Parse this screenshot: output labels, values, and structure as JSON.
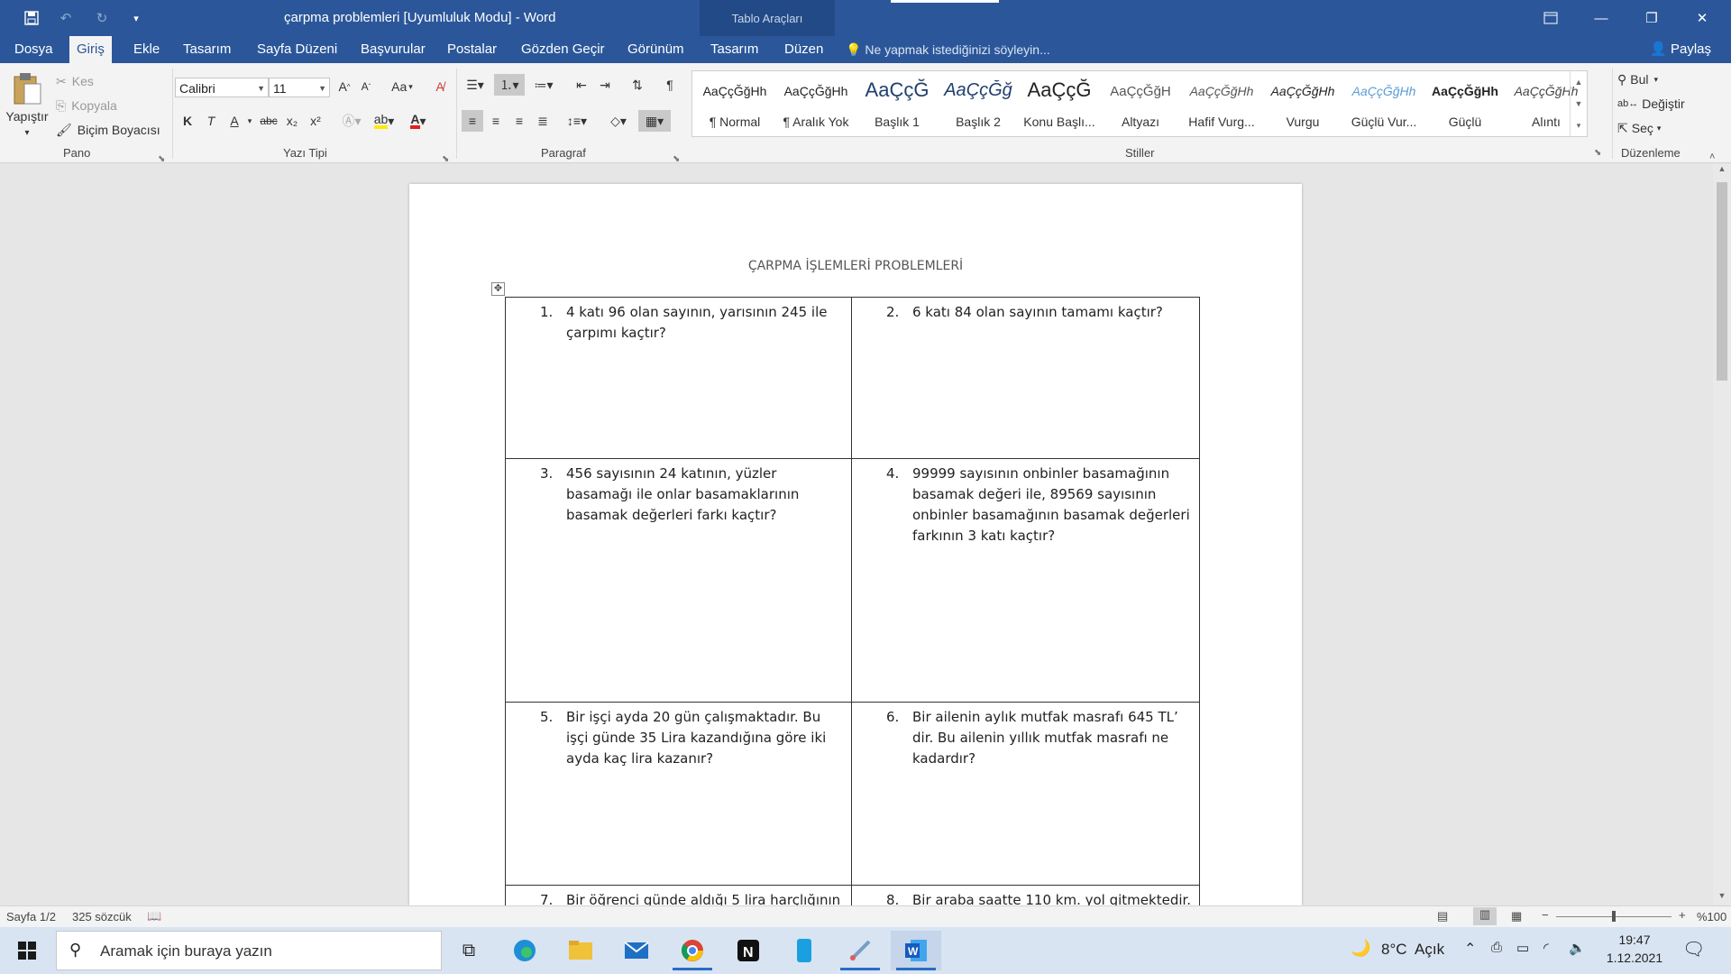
{
  "titlebar": {
    "doc_title": "çarpma problemleri [Uyumluluk Modu] - Word",
    "context_group": "Tablo Araçları"
  },
  "tabs": [
    "Dosya",
    "Giriş",
    "Ekle",
    "Tasarım",
    "Sayfa Düzeni",
    "Başvurular",
    "Postalar",
    "Gözden Geçir",
    "Görünüm",
    "Tasarım",
    "Düzen"
  ],
  "tell_me": "Ne yapmak istediğinizi söyleyin...",
  "share": "Paylaş",
  "ribbon": {
    "clipboard": {
      "paste": "Yapıştır",
      "cut": "Kes",
      "copy": "Kopyala",
      "format_painter": "Biçim Boyacısı",
      "label": "Pano"
    },
    "font": {
      "name": "Calibri",
      "size": "11",
      "label": "Yazı Tipi",
      "bold": "K",
      "italic": "T",
      "underline": "A",
      "strike": "abc",
      "sub": "x₂",
      "sup": "x²",
      "case": "Aa",
      "grow": "A",
      "shrink": "A"
    },
    "paragraph": {
      "label": "Paragraf"
    },
    "styles": {
      "label": "Stiller",
      "items": [
        {
          "preview": "AaÇçĞğHh",
          "name": "¶ Normal"
        },
        {
          "preview": "AaÇçĞğHh",
          "name": "¶ Aralık Yok"
        },
        {
          "preview": "AaÇçĞ",
          "name": "Başlık 1"
        },
        {
          "preview": "AaÇçĞğ",
          "name": "Başlık 2"
        },
        {
          "preview": "AaÇçĞ",
          "name": "Konu Başlı..."
        },
        {
          "preview": "AaÇçĞğH",
          "name": "Altyazı"
        },
        {
          "preview": "AaÇçĞğHh",
          "name": "Hafif Vurg..."
        },
        {
          "preview": "AaÇçĞğHh",
          "name": "Vurgu"
        },
        {
          "preview": "AaÇçĞğHh",
          "name": "Güçlü Vur..."
        },
        {
          "preview": "AaÇçĞğHh",
          "name": "Güçlü"
        },
        {
          "preview": "AaÇçĞğHh",
          "name": "Alıntı"
        }
      ]
    },
    "editing": {
      "find": "Bul",
      "replace": "Değiştir",
      "select": "Seç",
      "label": "Düzenleme"
    }
  },
  "document": {
    "heading": "ÇARPMA İŞLEMLERİ PROBLEMLERİ",
    "questions": [
      {
        "num": "1.",
        "text": "4 katı 96 olan sayının, yarısının 245 ile çarpımı kaçtır?"
      },
      {
        "num": "2.",
        "text": "6 katı 84 olan sayının tamamı kaçtır?"
      },
      {
        "num": "3.",
        "text": "456 sayısının 24 katının, yüzler basamağı ile onlar basamaklarının basamak değerleri farkı kaçtır?"
      },
      {
        "num": "4.",
        "text": "99999 sayısının onbinler basamağının basamak değeri ile, 89569 sayısının onbinler  basamağının basamak değerleri farkının 3 katı kaçtır?"
      },
      {
        "num": "5.",
        "text": "Bir işçi ayda 20 gün çalışmaktadır. Bu işçi günde 35 Lira kazandığına göre iki ayda kaç lira kazanır?"
      },
      {
        "num": "6.",
        "text": "Bir ailenin aylık mutfak masrafı 645 TL’ dir. Bu ailenin yıllık mutfak masrafı ne kadardır?"
      },
      {
        "num": "7.",
        "text": "Bir öğrenci  günde aldığı 5 lira harçlığının"
      },
      {
        "num": "8.",
        "text": "Bir araba saatte 110 km. yol gitmektedir."
      }
    ]
  },
  "status": {
    "page": "Sayfa 1/2",
    "words": "325 sözcük",
    "zoom": "%100",
    "zoom_level": 1.0
  },
  "taskbar": {
    "search_placeholder": "Aramak için buraya yazın",
    "weather": "8°C  Açık",
    "time": "19:47",
    "date": "1.12.2021"
  },
  "colors": {
    "word_blue": "#2b579a",
    "ribbon_bg": "#f3f3f3",
    "taskbar": "#d8e4f2"
  }
}
